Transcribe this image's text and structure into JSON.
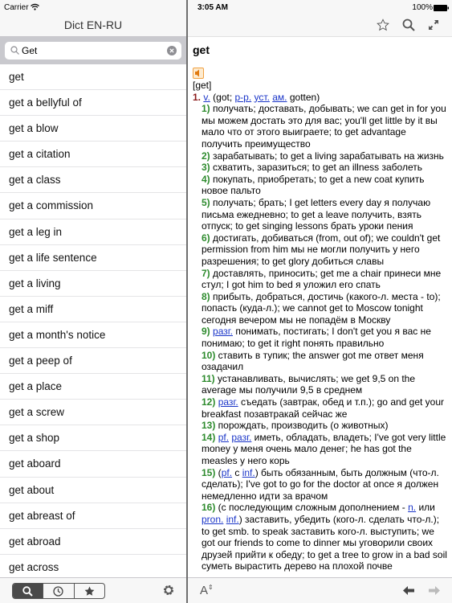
{
  "status": {
    "carrier": "Carrier",
    "time": "3:05 AM",
    "battery": "100%"
  },
  "left": {
    "title": "Dict EN-RU",
    "search": {
      "value": "Get"
    },
    "items": [
      "get",
      "get a bellyful of",
      "get a blow",
      "get a citation",
      "get a class",
      "get a commission",
      "get a leg in",
      "get a life sentence",
      "get a living",
      "get a miff",
      "get a month's notice",
      "get a peep of",
      "get a place",
      "get a screw",
      "get a shop",
      "get aboard",
      "get about",
      "get abreast of",
      "get abroad",
      "get across"
    ],
    "toolbar": {
      "tabs": [
        "search-icon",
        "clock-icon",
        "star-icon"
      ],
      "selected": "search-icon",
      "settings": "gear-icon"
    }
  },
  "right": {
    "toolbar_icons": [
      "star-outline-icon",
      "search-icon",
      "expand-icon"
    ],
    "headword": "get",
    "transcription": "[get]",
    "pos": {
      "num": "1.",
      "parts": [
        {
          "l": "v."
        },
        {
          "t": " (got; "
        },
        {
          "l": "p-p."
        },
        {
          "t": " "
        },
        {
          "l": "уст."
        },
        {
          "t": " "
        },
        {
          "l": "ам."
        },
        {
          "t": " gotten)"
        }
      ]
    },
    "senses": [
      {
        "n": "1)",
        "parts": [
          {
            "t": " получать; доставать, добывать; we can get in for you мы можем достать это для вас; you'll get little by it вы мало что от этого выиграете; to get advantage получить преимущество"
          }
        ]
      },
      {
        "n": "2)",
        "parts": [
          {
            "t": " зарабатывать; to get a living зарабатывать на жизнь"
          }
        ]
      },
      {
        "n": "3)",
        "parts": [
          {
            "t": " схватить, заразиться; to get an illness заболеть"
          }
        ]
      },
      {
        "n": "4)",
        "parts": [
          {
            "t": " покупать, приобретать; to get a new coat купить новое пальто"
          }
        ]
      },
      {
        "n": "5)",
        "parts": [
          {
            "t": " получать; брать; I get letters every day я получаю письма ежедневно; to get a leave получить, взять отпуск; to get singing lessons брать уроки пения"
          }
        ]
      },
      {
        "n": "6)",
        "parts": [
          {
            "t": " достигать, добиваться (from, out of); we couldn't get permission from him мы не могли получить у него разрешения; to get glory добиться славы"
          }
        ]
      },
      {
        "n": "7)",
        "parts": [
          {
            "t": " доставлять, приносить; get me a chair принеси мне стул; I got him to bed я уложил его спать"
          }
        ]
      },
      {
        "n": "8)",
        "parts": [
          {
            "t": " прибыть, добраться, достичь (какого-л. места - to); попасть (куда-л.); we cannot get to Moscow tonight сегодня вечером мы не попадём в Москву"
          }
        ]
      },
      {
        "n": "9)",
        "parts": [
          {
            "t": " "
          },
          {
            "l": "разг."
          },
          {
            "t": " понимать, постигать; I don't get you я вас не понимаю; to get it right понять правильно"
          }
        ]
      },
      {
        "n": "10)",
        "parts": [
          {
            "t": " ставить в тупик; the answer got me ответ меня озадачил"
          }
        ]
      },
      {
        "n": "11)",
        "parts": [
          {
            "t": " устанавливать, вычислять; we get 9,5 on the average мы получили 9,5 в среднем"
          }
        ]
      },
      {
        "n": "12)",
        "parts": [
          {
            "t": " "
          },
          {
            "l": "разг."
          },
          {
            "t": " съедать (завтрак, обед и т.п.); go and get your breakfast позавтракай сейчас же"
          }
        ]
      },
      {
        "n": "13)",
        "parts": [
          {
            "t": " порождать, производить (о животных)"
          }
        ]
      },
      {
        "n": "14)",
        "parts": [
          {
            "t": " "
          },
          {
            "l": "pf."
          },
          {
            "t": " "
          },
          {
            "l": "разг."
          },
          {
            "t": " иметь, обладать, владеть; I've got very little money у меня очень мало денег; he has got the measles у него корь"
          }
        ]
      },
      {
        "n": "15)",
        "parts": [
          {
            "t": " ("
          },
          {
            "l": "pf."
          },
          {
            "t": " с "
          },
          {
            "l": "inf."
          },
          {
            "t": ") быть обязанным, быть должным (что-л. сделать); I've got to go for the doctor at once я должен немедленно идти за врачом"
          }
        ]
      },
      {
        "n": "16)",
        "parts": [
          {
            "t": " (с последующим сложным дополнением - "
          },
          {
            "l": "n."
          },
          {
            "t": " или "
          },
          {
            "l": "pron."
          },
          {
            "t": " "
          },
          {
            "l": "inf."
          },
          {
            "t": ") заставить, убедить (кого-л. сделать что-л.); to get smb. to speak заставить кого-л. выступить; we got our friends to come to dinner мы уговорили своих друзей прийти к обеду; to get a tree to grow in a bad soil суметь вырастить дерево на плохой почве"
          }
        ]
      }
    ],
    "bottom_icons": [
      "font-size-icon",
      "back-arrow-icon",
      "forward-arrow-icon"
    ]
  },
  "colors": {
    "sense_num": "#2e8b2e",
    "pos_num": "#8b1a1a",
    "link": "#1a35c8"
  }
}
